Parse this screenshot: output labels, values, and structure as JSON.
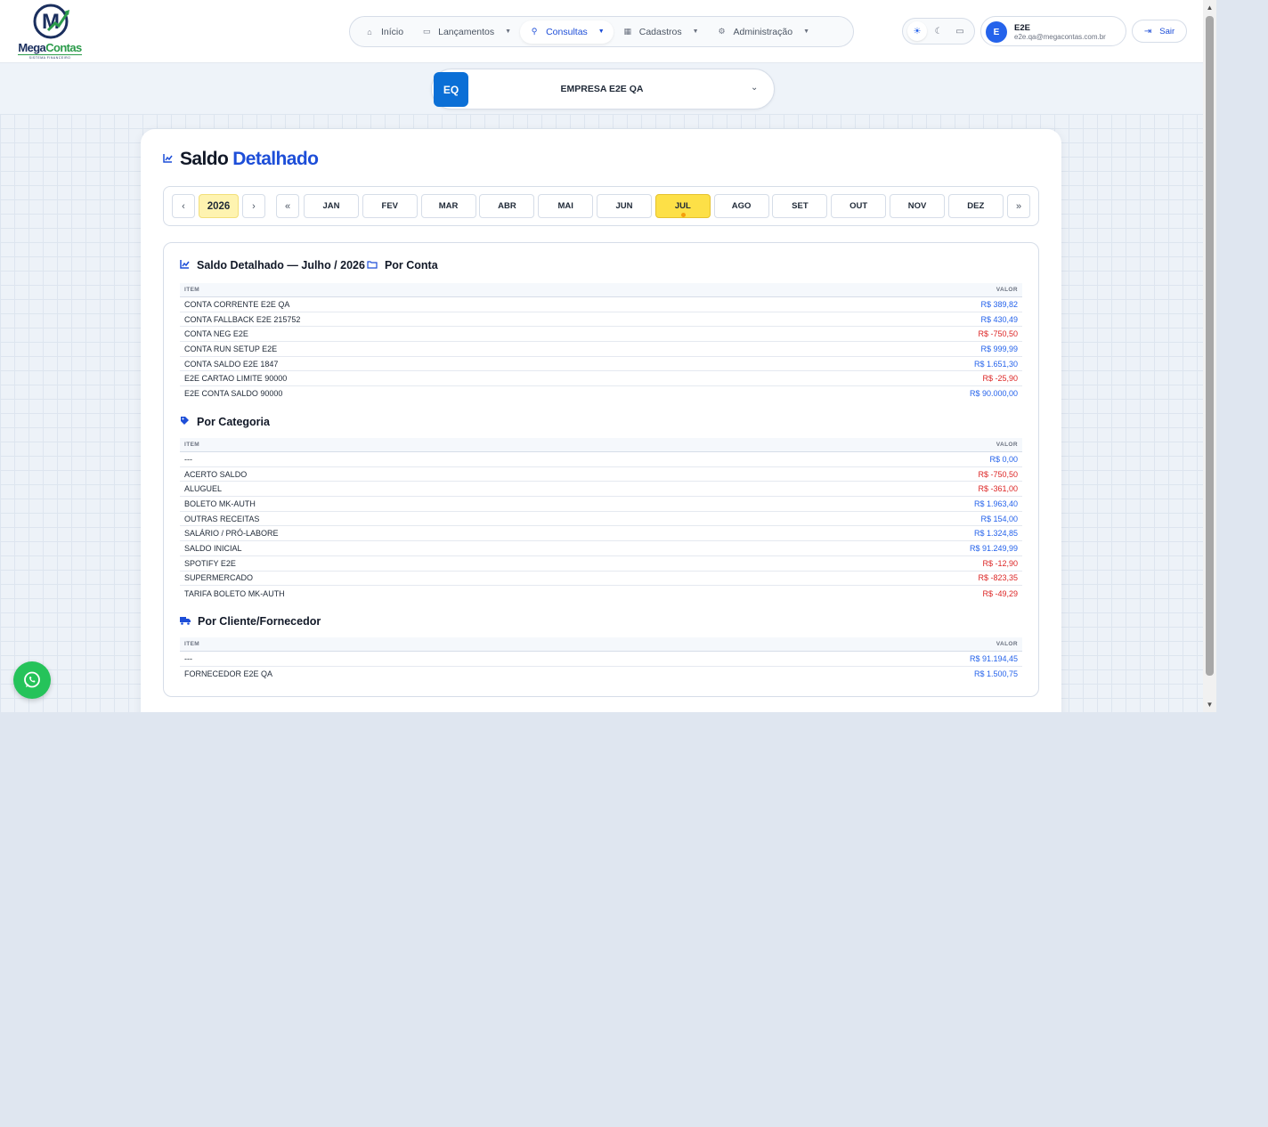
{
  "brand": {
    "name_part1": "Mega",
    "name_part2": "Contas",
    "tagline": "SISTEMA FINANCEIRO",
    "mark_letter": "M",
    "green": "#2b9b4a",
    "navy": "#1b2f5e"
  },
  "nav": {
    "items": [
      {
        "label": "Início",
        "icon": "home-icon",
        "has_dropdown": false
      },
      {
        "label": "Lançamentos",
        "icon": "folder-icon",
        "has_dropdown": true
      },
      {
        "label": "Consultas",
        "icon": "search-icon",
        "has_dropdown": true,
        "active": true
      },
      {
        "label": "Cadastros",
        "icon": "grid-icon",
        "has_dropdown": true
      },
      {
        "label": "Administração",
        "icon": "gear-icon",
        "has_dropdown": true
      }
    ]
  },
  "theme": {
    "icons": [
      "sun-icon",
      "moon-icon",
      "monitor-icon"
    ],
    "active": "sun-icon"
  },
  "user": {
    "initial": "E",
    "name": "E2E",
    "email": "e2e.qa@megacontas.com.br"
  },
  "logout": {
    "label": "Sair"
  },
  "company": {
    "badge": "EQ",
    "name": "EMPRESA E2E QA"
  },
  "page": {
    "title_part1": "Saldo",
    "title_part2": "Detalhado"
  },
  "period": {
    "year": "2026",
    "months": [
      "JAN",
      "FEV",
      "MAR",
      "ABR",
      "MAI",
      "JUN",
      "JUL",
      "AGO",
      "SET",
      "OUT",
      "NOV",
      "DEZ"
    ],
    "selected": "JUL"
  },
  "report": {
    "heading": "Saldo Detalhado — Julho / 2026",
    "col_item": "ITEM",
    "col_value": "VALOR",
    "por_conta": {
      "title": "Por Conta",
      "rows": [
        {
          "item": "CONTA CORRENTE E2E QA",
          "value": "R$ 389,82",
          "sign": "pos"
        },
        {
          "item": "CONTA FALLBACK E2E 215752",
          "value": "R$ 430,49",
          "sign": "pos"
        },
        {
          "item": "CONTA NEG E2E",
          "value": "R$ -750,50",
          "sign": "neg"
        },
        {
          "item": "CONTA RUN SETUP E2E",
          "value": "R$ 999,99",
          "sign": "pos"
        },
        {
          "item": "CONTA SALDO E2E 1847",
          "value": "R$ 1.651,30",
          "sign": "pos"
        },
        {
          "item": "E2E CARTAO LIMITE 90000",
          "value": "R$ -25,90",
          "sign": "neg"
        },
        {
          "item": "E2E CONTA SALDO 90000",
          "value": "R$ 90.000,00",
          "sign": "pos"
        }
      ]
    },
    "por_categoria": {
      "title": "Por Categoria",
      "rows": [
        {
          "item": "---",
          "value": "R$ 0,00",
          "sign": "pos"
        },
        {
          "item": "ACERTO SALDO",
          "value": "R$ -750,50",
          "sign": "neg"
        },
        {
          "item": "ALUGUEL",
          "value": "R$ -361,00",
          "sign": "neg"
        },
        {
          "item": "BOLETO MK-AUTH",
          "value": "R$ 1.963,40",
          "sign": "pos"
        },
        {
          "item": "OUTRAS RECEITAS",
          "value": "R$ 154,00",
          "sign": "pos"
        },
        {
          "item": "SALÁRIO / PRÓ-LABORE",
          "value": "R$ 1.324,85",
          "sign": "pos"
        },
        {
          "item": "SALDO INICIAL",
          "value": "R$ 91.249,99",
          "sign": "pos"
        },
        {
          "item": "SPOTIFY E2E",
          "value": "R$ -12,90",
          "sign": "neg"
        },
        {
          "item": "SUPERMERCADO",
          "value": "R$ -823,35",
          "sign": "neg"
        },
        {
          "item": "TARIFA BOLETO MK-AUTH",
          "value": "R$ -49,29",
          "sign": "neg"
        }
      ]
    },
    "por_cliente": {
      "title": "Por Cliente/Fornecedor",
      "rows": [
        {
          "item": "---",
          "value": "R$ 91.194,45",
          "sign": "pos"
        },
        {
          "item": "FORNECEDOR E2E QA",
          "value": "R$ 1.500,75",
          "sign": "pos"
        }
      ]
    }
  },
  "colors": {
    "accent": "#1d4ed8",
    "positive": "#2563eb",
    "negative": "#dc2626",
    "selected_month": "#fde047",
    "whatsapp": "#25c35a"
  }
}
